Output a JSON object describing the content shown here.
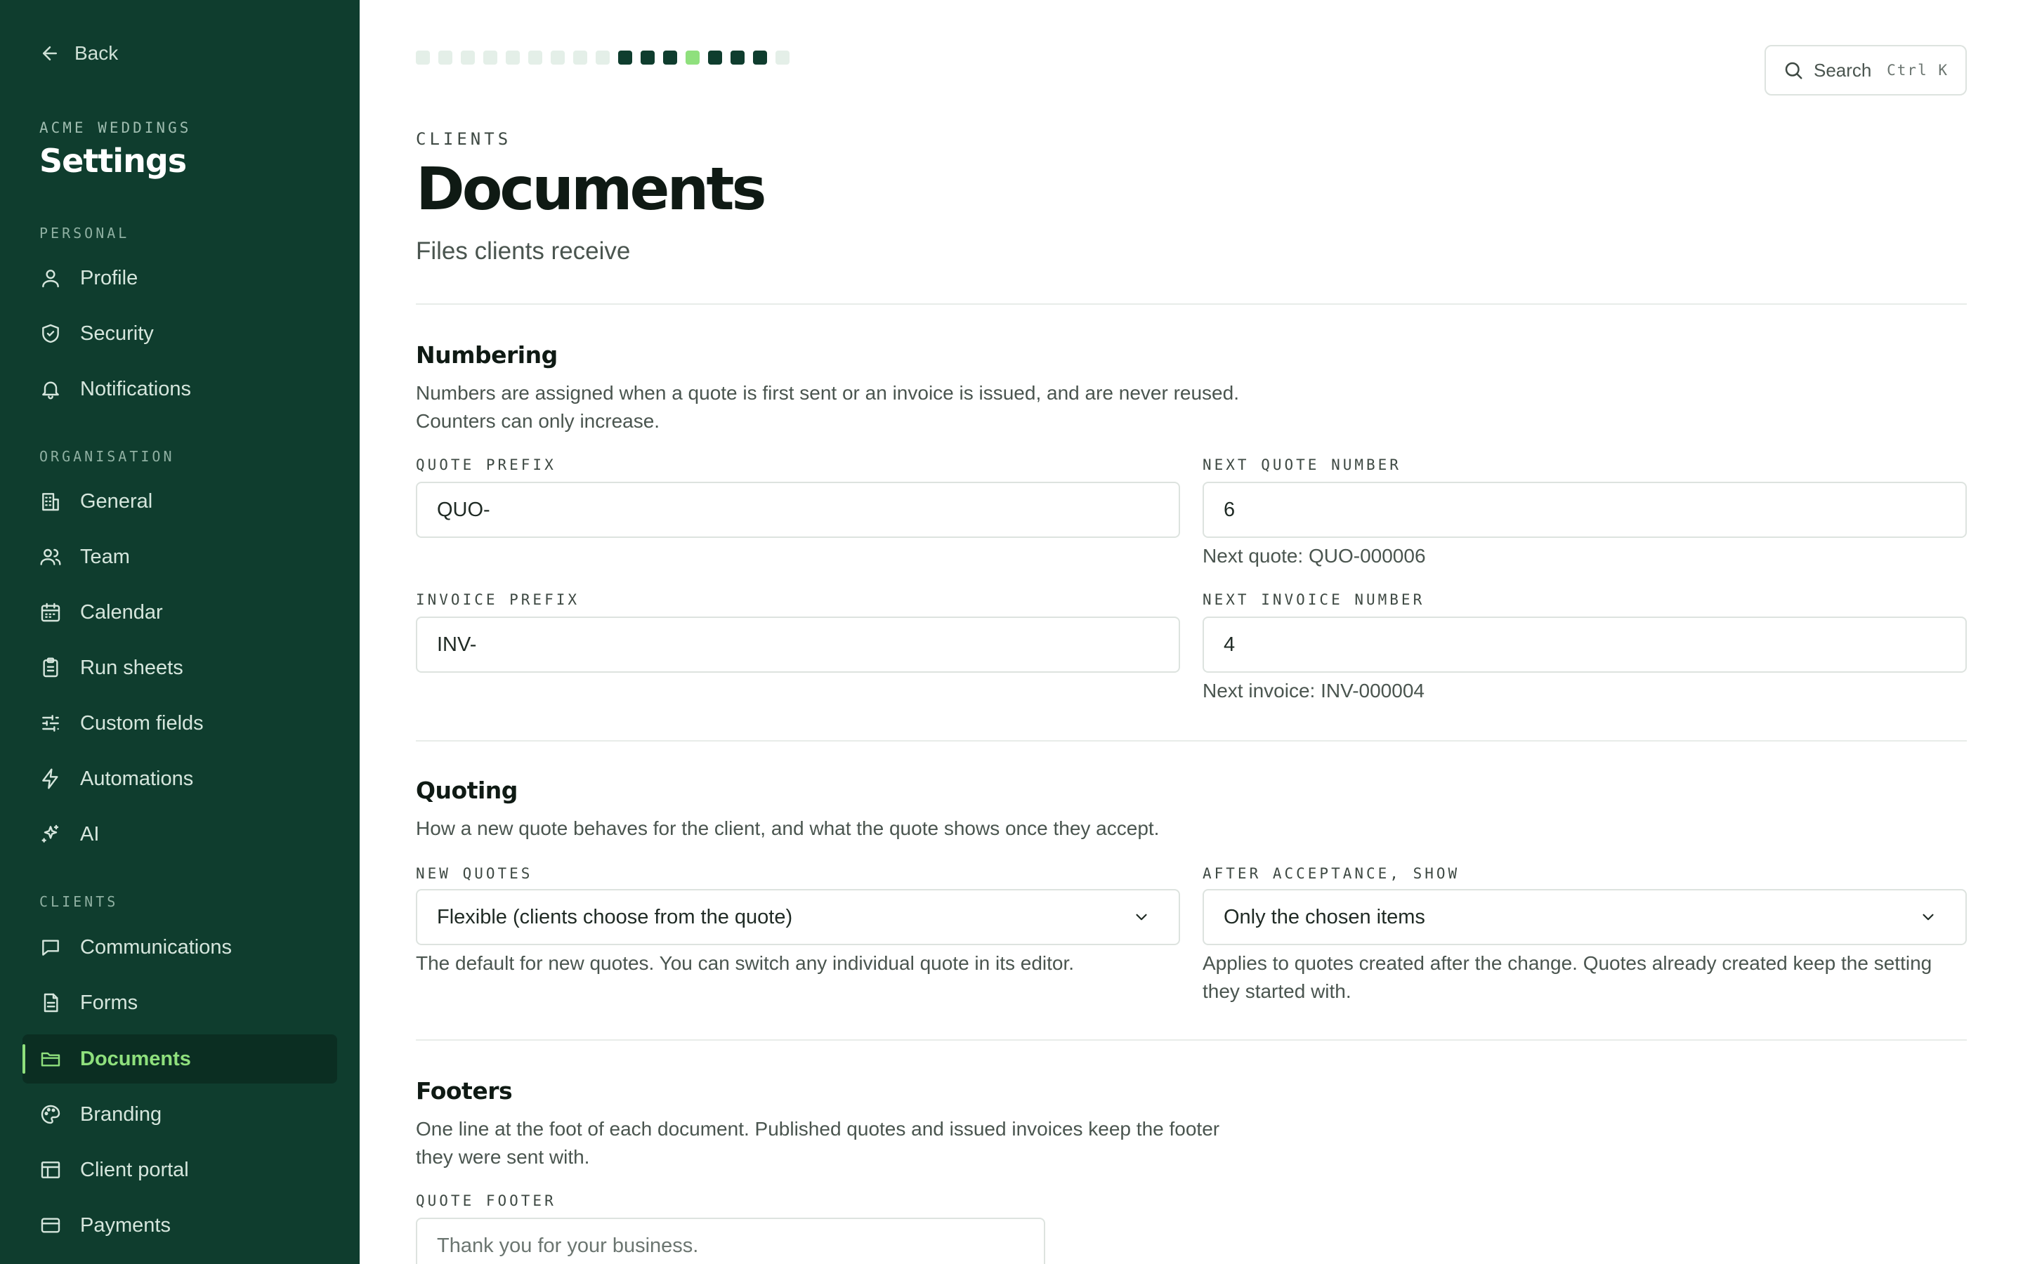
{
  "sidebar": {
    "back_label": "Back",
    "org_name": "ACME WEDDINGS",
    "title": "Settings",
    "sections": [
      {
        "label": "PERSONAL",
        "items": [
          {
            "label": "Profile",
            "icon": "user-icon"
          },
          {
            "label": "Security",
            "icon": "shield-icon"
          },
          {
            "label": "Notifications",
            "icon": "bell-icon"
          }
        ]
      },
      {
        "label": "ORGANISATION",
        "items": [
          {
            "label": "General",
            "icon": "building-icon"
          },
          {
            "label": "Team",
            "icon": "users-icon"
          },
          {
            "label": "Calendar",
            "icon": "calendar-icon"
          },
          {
            "label": "Run sheets",
            "icon": "clipboard-icon"
          },
          {
            "label": "Custom fields",
            "icon": "sliders-icon"
          },
          {
            "label": "Automations",
            "icon": "lightning-icon"
          },
          {
            "label": "AI",
            "icon": "sparkles-icon"
          }
        ]
      },
      {
        "label": "CLIENTS",
        "items": [
          {
            "label": "Communications",
            "icon": "message-icon"
          },
          {
            "label": "Forms",
            "icon": "form-icon"
          },
          {
            "label": "Documents",
            "icon": "folder-icon",
            "active": true
          },
          {
            "label": "Branding",
            "icon": "palette-icon"
          },
          {
            "label": "Client portal",
            "icon": "layout-icon"
          },
          {
            "label": "Payments",
            "icon": "credit-card-icon"
          }
        ]
      }
    ]
  },
  "header": {
    "search_label": "Search",
    "search_shortcut": "Ctrl K",
    "progress": {
      "total_steps": 17,
      "current_step": 13,
      "colors": {
        "done": "#0f3d2e",
        "current": "#8fe07d",
        "pending": "#e4efe8"
      },
      "done_steps": [
        10,
        11,
        12,
        14,
        15,
        16
      ]
    }
  },
  "page": {
    "eyebrow": "CLIENTS",
    "title": "Documents",
    "subtitle": "Files clients receive"
  },
  "numbering": {
    "title": "Numbering",
    "description": "Numbers are assigned when a quote is first sent or an invoice is issued, and are never reused. Counters can only increase.",
    "quote_prefix_label": "QUOTE PREFIX",
    "quote_prefix_value": "QUO-",
    "next_quote_label": "NEXT QUOTE NUMBER",
    "next_quote_value": "6",
    "next_quote_hint": "Next quote: QUO-000006",
    "invoice_prefix_label": "INVOICE PREFIX",
    "invoice_prefix_value": "INV-",
    "next_invoice_label": "NEXT INVOICE NUMBER",
    "next_invoice_value": "4",
    "next_invoice_hint": "Next invoice: INV-000004"
  },
  "quoting": {
    "title": "Quoting",
    "description": "How a new quote behaves for the client, and what the quote shows once they accept.",
    "new_quotes_label": "NEW QUOTES",
    "new_quotes_value": "Flexible (clients choose from the quote)",
    "new_quotes_hint": "The default for new quotes. You can switch any individual quote in its editor.",
    "after_acceptance_label": "AFTER ACCEPTANCE, SHOW",
    "after_acceptance_value": "Only the chosen items",
    "after_acceptance_hint": "Applies to quotes created after the change. Quotes already created keep the setting they started with."
  },
  "footers": {
    "title": "Footers",
    "description": "One line at the foot of each document. Published quotes and issued invoices keep the footer they were sent with.",
    "quote_footer_label": "QUOTE FOOTER",
    "quote_footer_placeholder": "Thank you for your business."
  }
}
